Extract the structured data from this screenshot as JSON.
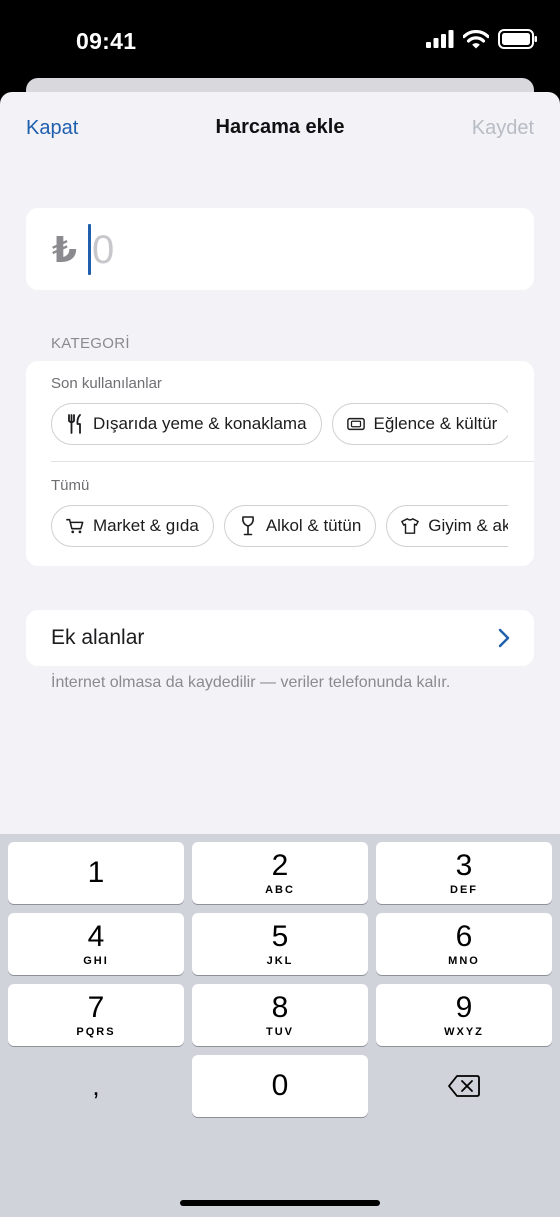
{
  "status_bar": {
    "time": "09:41"
  },
  "nav": {
    "cancel_label": "Kapat",
    "title": "Harcama ekle",
    "save_label": "Kaydet"
  },
  "amount": {
    "currency_symbol": "₺",
    "placeholder": "0"
  },
  "category": {
    "section_title": "KATEGORİ",
    "recent_label": "Son kullanılanlar",
    "recent": [
      {
        "label": "Dışarıda yeme & konaklama",
        "icon": "fork-knife-icon"
      },
      {
        "label": "Eğlence & kültür",
        "icon": "ticket-icon"
      }
    ],
    "all_label": "Tümü",
    "all": [
      {
        "label": "Market & gıda",
        "icon": "cart-icon"
      },
      {
        "label": "Alkol & tütün",
        "icon": "wine-glass-icon"
      },
      {
        "label": "Giyim & aksesuar",
        "icon": "tshirt-icon"
      }
    ]
  },
  "extra": {
    "label": "Ek alanlar"
  },
  "footnote": "İnternet olmasa da kaydedilir — veriler telefonunda kalır.",
  "keypad": {
    "keys": [
      {
        "digit": "1",
        "letters": ""
      },
      {
        "digit": "2",
        "letters": "ABC"
      },
      {
        "digit": "3",
        "letters": "DEF"
      },
      {
        "digit": "4",
        "letters": "GHI"
      },
      {
        "digit": "5",
        "letters": "JKL"
      },
      {
        "digit": "6",
        "letters": "MNO"
      },
      {
        "digit": "7",
        "letters": "PQRS"
      },
      {
        "digit": "8",
        "letters": "TUV"
      },
      {
        "digit": "9",
        "letters": "WXYZ"
      },
      {
        "digit": "0",
        "letters": ""
      }
    ],
    "comma": ",",
    "delete_icon": "backspace-icon"
  },
  "colors": {
    "accent": "#1f5fad",
    "background": "#f2f2f7",
    "keypad_bg": "#d0d3d9"
  }
}
